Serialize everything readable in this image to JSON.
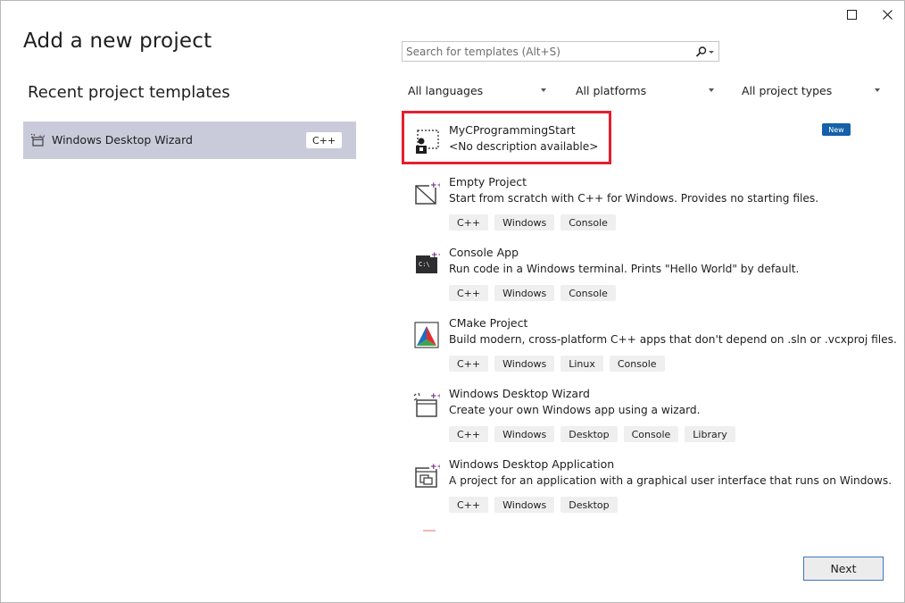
{
  "window": {
    "title": "Add a new project",
    "maximize_icon": "maximize-icon",
    "close_icon": "close-icon"
  },
  "recent": {
    "heading": "Recent project templates",
    "items": [
      {
        "label": "Windows Desktop Wizard",
        "tag": "C++",
        "icon": "windows-desktop-wizard-icon"
      }
    ]
  },
  "search": {
    "placeholder": "Search for templates (Alt+S)",
    "value": "",
    "icon": "search-icon"
  },
  "filters": {
    "language": "All languages",
    "platform": "All platforms",
    "project_type": "All project types"
  },
  "templates": [
    {
      "name": "MyCProgrammingStart",
      "description": "<No description available>",
      "badge": "New",
      "tags": [],
      "icon": "custom-template-icon"
    },
    {
      "name": "Empty Project",
      "description": "Start from scratch with C++ for Windows. Provides no starting files.",
      "tags": [
        "C++",
        "Windows",
        "Console"
      ],
      "icon": "empty-project-icon"
    },
    {
      "name": "Console App",
      "description": "Run code in a Windows terminal. Prints \"Hello World\" by default.",
      "tags": [
        "C++",
        "Windows",
        "Console"
      ],
      "icon": "console-app-icon"
    },
    {
      "name": "CMake Project",
      "description": "Build modern, cross-platform C++ apps that don't depend on .sln or .vcxproj files.",
      "tags": [
        "C++",
        "Windows",
        "Linux",
        "Console"
      ],
      "icon": "cmake-icon"
    },
    {
      "name": "Windows Desktop Wizard",
      "description": "Create your own Windows app using a wizard.",
      "tags": [
        "C++",
        "Windows",
        "Desktop",
        "Console",
        "Library"
      ],
      "icon": "windows-desktop-wizard-icon"
    },
    {
      "name": "Windows Desktop Application",
      "description": "A project for an application with a graphical user interface that runs on Windows.",
      "tags": [
        "C++",
        "Windows",
        "Desktop"
      ],
      "icon": "windows-desktop-application-icon"
    }
  ],
  "colors": {
    "selected_bg": "#c9cbdb",
    "highlight_border": "#e4202e",
    "badge_bg": "#1460aa",
    "cpp_purple": "#68217a"
  },
  "footer": {
    "next_label": "Next"
  }
}
